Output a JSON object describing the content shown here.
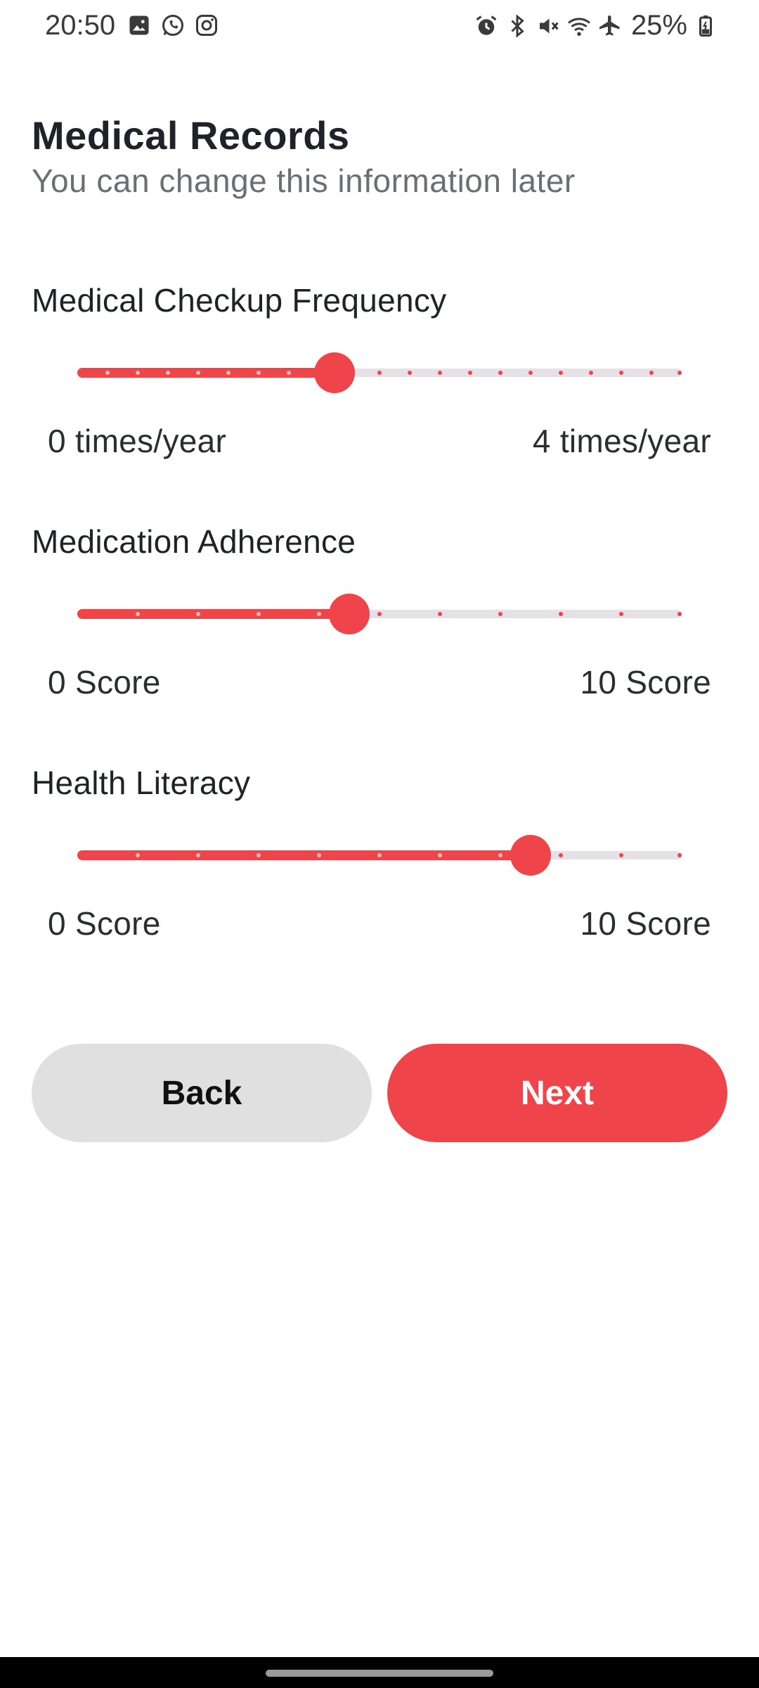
{
  "status_bar": {
    "time": "20:50",
    "battery": "25%",
    "left_icons": [
      "image-icon",
      "whatsapp-icon",
      "instagram-icon"
    ],
    "right_icons": [
      "alarm-icon",
      "bluetooth-icon",
      "mute-icon",
      "wifi-icon",
      "airplane-icon",
      "battery-icon"
    ]
  },
  "header": {
    "title": "Medical Records",
    "subtitle": "You can change this information later"
  },
  "sliders": [
    {
      "label": "Medical Checkup Frequency",
      "min_label": "0 times/year",
      "max_label": "4 times/year",
      "value_fraction": 0.425
    },
    {
      "label": "Medication Adherence",
      "min_label": "0 Score",
      "max_label": "10 Score",
      "value_fraction": 0.45
    },
    {
      "label": "Health Literacy",
      "min_label": "0 Score",
      "max_label": "10 Score",
      "value_fraction": 0.75
    }
  ],
  "buttons": {
    "back": "Back",
    "next": "Next"
  },
  "colors": {
    "accent": "#f0444b",
    "back_button": "#e0e0e0",
    "track_inactive": "#e6e1e6",
    "title": "#1f2329",
    "subtitle": "#6b6f75"
  }
}
